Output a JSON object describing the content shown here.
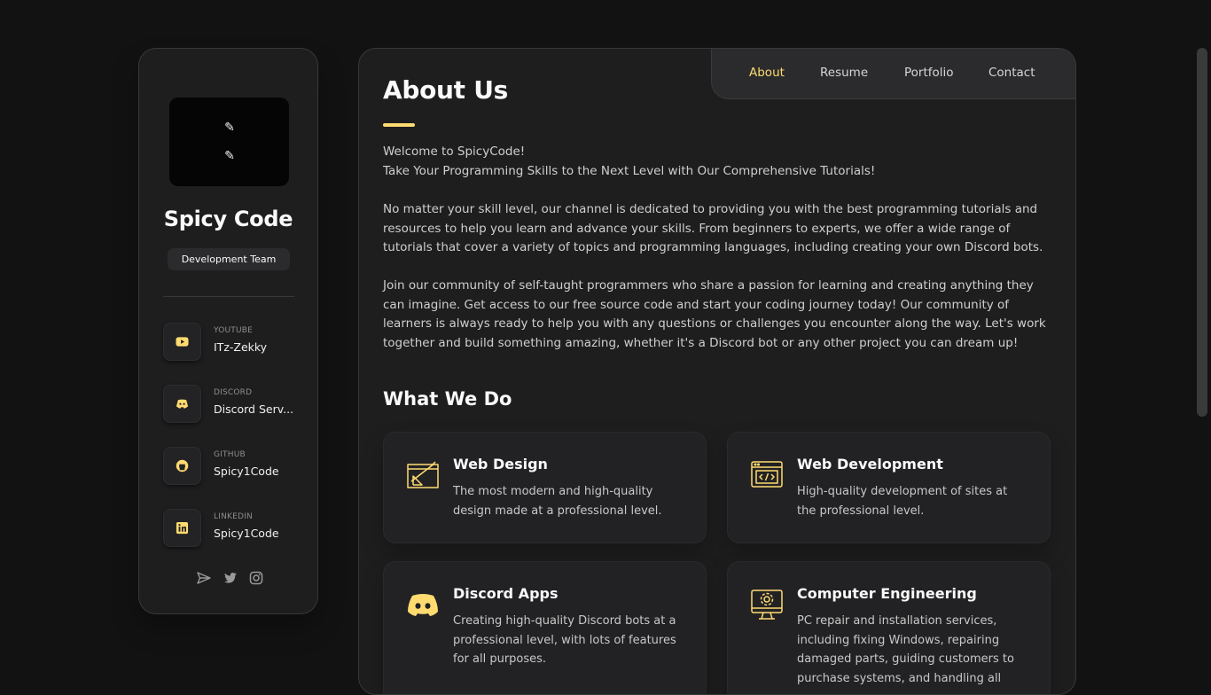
{
  "sidebar": {
    "name": "Spicy Code",
    "role": "Development Team",
    "contacts": [
      {
        "title": "YOUTUBE",
        "value": "ITz-Zekky",
        "icon": "youtube-icon"
      },
      {
        "title": "DISCORD",
        "value": "Discord Serv...",
        "icon": "discord-icon"
      },
      {
        "title": "GITHUB",
        "value": "Spicy1Code",
        "icon": "github-icon"
      },
      {
        "title": "LINKEDIN",
        "value": "Spicy1Code",
        "icon": "linkedin-icon"
      }
    ],
    "socials": [
      "send-icon",
      "twitter-icon",
      "instagram-icon"
    ]
  },
  "navbar": {
    "items": [
      {
        "label": "About",
        "active": true
      },
      {
        "label": "Resume",
        "active": false
      },
      {
        "label": "Portfolio",
        "active": false
      },
      {
        "label": "Contact",
        "active": false
      }
    ]
  },
  "about": {
    "title": "About Us",
    "paragraph1_line1": "Welcome to SpicyCode!",
    "paragraph1_line2": "Take Your Programming Skills to the Next Level with Our Comprehensive Tutorials!",
    "paragraph2": "No matter your skill level, our channel is dedicated to providing you with the best programming tutorials and resources to help you learn and advance your skills. From beginners to experts, we offer a wide range of tutorials that cover a variety of topics and programming languages, including creating your own Discord bots.",
    "paragraph3": "Join our community of self-taught programmers who share a passion for learning and creating anything they can imagine. Get access to our free source code and start your coding journey today! Our community of learners is always ready to help you with any questions or challenges you encounter along the way. Let's work together and build something amazing, whether it's a Discord bot or any other project you can dream up!"
  },
  "services": {
    "title": "What We Do",
    "items": [
      {
        "title": "Web Design",
        "text": "The most modern and high-quality design made at a professional level.",
        "icon": "design-icon"
      },
      {
        "title": "Web Development",
        "text": "High-quality development of sites at the professional level.",
        "icon": "code-icon"
      },
      {
        "title": "Discord Apps",
        "text": "Creating high-quality Discord bots at a professional level, with lots of features for all purposes.",
        "icon": "discord-icon"
      },
      {
        "title": "Computer Engineering",
        "text": "PC repair and installation services, including fixing Windows, repairing damaged parts, guiding customers to purchase systems, and handling all",
        "icon": "computer-icon"
      }
    ]
  },
  "colors": {
    "accent": "#ffdb70",
    "background": "#121212",
    "panel": "#1e1e1f"
  }
}
